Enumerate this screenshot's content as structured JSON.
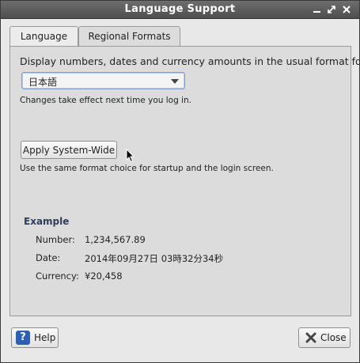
{
  "window": {
    "title": "Language Support"
  },
  "tabs": [
    {
      "label": "Language"
    },
    {
      "label": "Regional Formats"
    }
  ],
  "regional": {
    "prompt": "Display numbers, dates and currency amounts in the usual format for:",
    "format_selected": "日本語",
    "hint": "Changes take effect next time you log in.",
    "apply_button": "Apply System-Wide",
    "apply_hint": "Use the same format choice for startup and the login screen."
  },
  "example": {
    "heading": "Example",
    "number_label": "Number:",
    "number_value": "1,234,567.89",
    "date_label": "Date:",
    "date_value": "2014年09月27日 03時32分34秒",
    "currency_label": "Currency:",
    "currency_value": "¥20,458"
  },
  "footer": {
    "help_label": "Help",
    "close_label": "Close"
  }
}
